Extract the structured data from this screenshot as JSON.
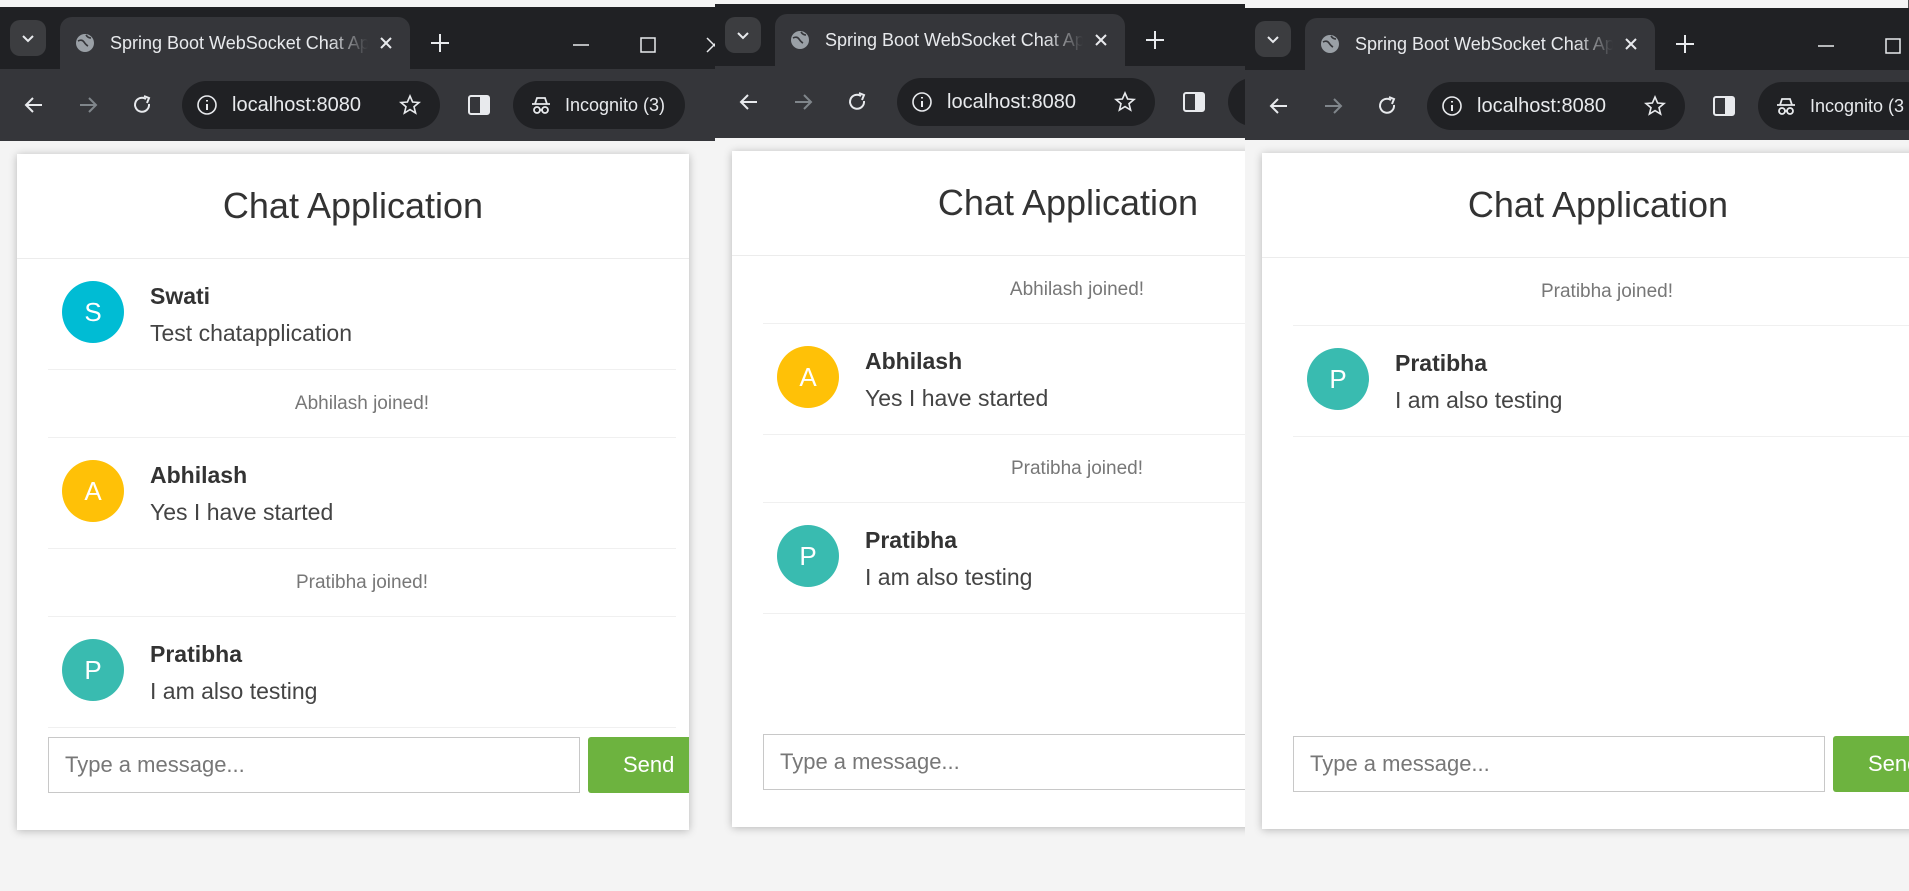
{
  "colors": {
    "chrome_frame": "#202124",
    "chrome_toolbar": "#35363a",
    "send_button": "#6db33f",
    "avatar_S": "#00bcd4",
    "avatar_A": "#ffc107",
    "avatar_P": "#39bbb0"
  },
  "windows": [
    {
      "tab_title": "Spring Boot WebSocket Chat Ap",
      "url": "localhost:8080",
      "incognito_label": "Incognito (3)",
      "chat": {
        "title": "Chat Application",
        "messages": [
          {
            "type": "chat",
            "avatar_letter": "S",
            "avatar_color": "#00bcd4",
            "sender": "Swati",
            "text": "Test chatapplication"
          },
          {
            "type": "event",
            "text": "Abhilash joined!"
          },
          {
            "type": "chat",
            "avatar_letter": "A",
            "avatar_color": "#ffc107",
            "sender": "Abhilash",
            "text": "Yes I have started"
          },
          {
            "type": "event",
            "text": "Pratibha joined!"
          },
          {
            "type": "chat",
            "avatar_letter": "P",
            "avatar_color": "#39bbb0",
            "sender": "Pratibha",
            "text": "I am also testing"
          }
        ],
        "input_placeholder": "Type a message...",
        "send_label": "Send"
      }
    },
    {
      "tab_title": "Spring Boot WebSocket Chat Ap",
      "url": "localhost:8080",
      "incognito_label": "",
      "chat": {
        "title": "Chat Application",
        "messages": [
          {
            "type": "event",
            "text": "Abhilash joined!"
          },
          {
            "type": "chat",
            "avatar_letter": "A",
            "avatar_color": "#ffc107",
            "sender": "Abhilash",
            "text": "Yes I have started"
          },
          {
            "type": "event",
            "text": "Pratibha joined!"
          },
          {
            "type": "chat",
            "avatar_letter": "P",
            "avatar_color": "#39bbb0",
            "sender": "Pratibha",
            "text": "I am also testing"
          }
        ],
        "input_placeholder": "Type a message...",
        "send_label": ""
      }
    },
    {
      "tab_title": "Spring Boot WebSocket Chat Ap",
      "url": "localhost:8080",
      "incognito_label": "Incognito (3",
      "chat": {
        "title": "Chat Application",
        "messages": [
          {
            "type": "event",
            "text": "Pratibha joined!"
          },
          {
            "type": "chat",
            "avatar_letter": "P",
            "avatar_color": "#39bbb0",
            "sender": "Pratibha",
            "text": "I am also testing"
          }
        ],
        "input_placeholder": "Type a message...",
        "send_label": "Send"
      }
    }
  ]
}
